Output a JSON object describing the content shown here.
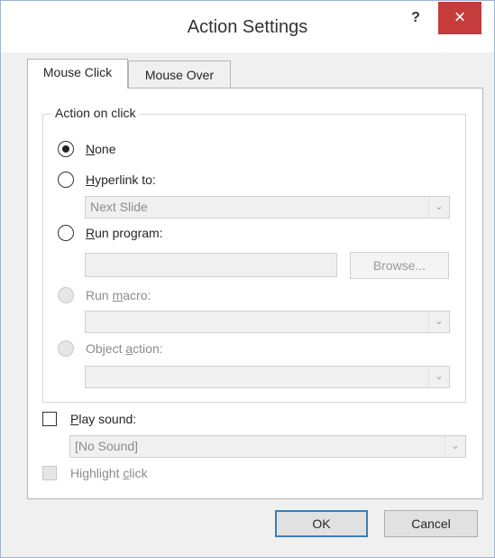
{
  "window": {
    "title": "Action Settings",
    "help_icon": "?",
    "close_icon": "×"
  },
  "tabs": [
    {
      "label": "Mouse Click",
      "selected": true
    },
    {
      "label": "Mouse Over",
      "selected": false
    }
  ],
  "action_group": {
    "legend": "Action on click",
    "none": {
      "pre": "",
      "key": "N",
      "post": "one",
      "checked": true
    },
    "hyperlink": {
      "pre": "",
      "key": "H",
      "post": "yperlink to:",
      "value": "Next Slide"
    },
    "run_program": {
      "pre": "",
      "key": "R",
      "post": "un program:",
      "value": "",
      "browse_label": "Browse..."
    },
    "run_macro": {
      "pre": "Run ",
      "key": "m",
      "post": "acro:",
      "value": ""
    },
    "object_action": {
      "pre": "Object ",
      "key": "a",
      "post": "ction:",
      "value": ""
    }
  },
  "play_sound": {
    "pre": "",
    "key": "P",
    "post": "lay sound:",
    "value": "[No Sound]",
    "checked": false
  },
  "highlight_click": {
    "pre": "Highlight ",
    "key": "c",
    "post": "lick",
    "checked": false
  },
  "buttons": {
    "ok": "OK",
    "cancel": "Cancel"
  },
  "colors": {
    "close_bg": "#c63b3b",
    "ok_border": "#3c7fb1",
    "window_border": "#9fb4d0"
  }
}
